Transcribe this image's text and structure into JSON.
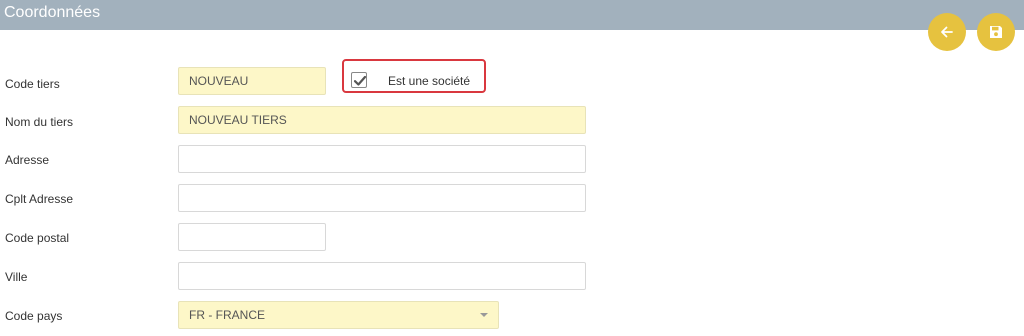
{
  "header": {
    "title": "Coordonnées"
  },
  "actions": {
    "back_icon": "arrow-left-icon",
    "save_icon": "floppy-disk-icon",
    "accent_color": "#e6c23f"
  },
  "form": {
    "code_tiers": {
      "label": "Code tiers",
      "value": "NOUVEAU"
    },
    "est_societe": {
      "label": "Est une société",
      "checked": true
    },
    "nom_tiers": {
      "label": "Nom du tiers",
      "value": "NOUVEAU TIERS"
    },
    "adresse": {
      "label": "Adresse",
      "value": ""
    },
    "cplt_adresse": {
      "label": "Cplt Adresse",
      "value": ""
    },
    "code_postal": {
      "label": "Code postal",
      "value": ""
    },
    "ville": {
      "label": "Ville",
      "value": ""
    },
    "code_pays": {
      "label": "Code pays",
      "value": "FR - FRANCE"
    }
  }
}
